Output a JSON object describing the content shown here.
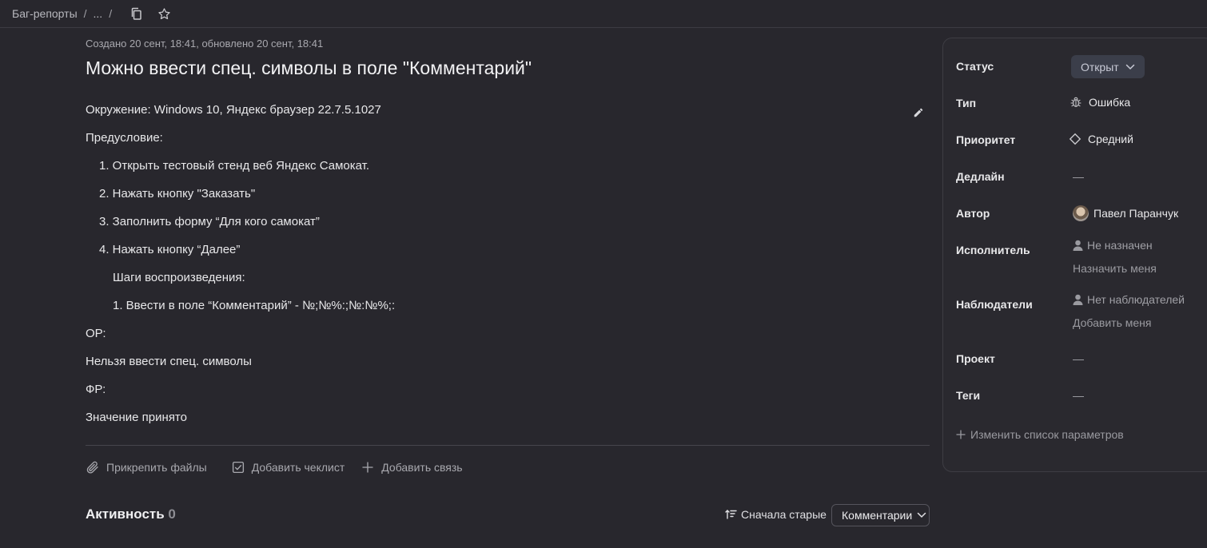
{
  "breadcrumb": {
    "root": "Баг-репорты",
    "ellipsis": "...",
    "separator": "/"
  },
  "issue": {
    "meta": "Создано 20 сент, 18:41, обновлено 20 сент, 18:41",
    "title": "Можно ввести спец. символы в поле \"Комментарий\"",
    "description": [
      "Окружение: Windows 10, Яндекс браузер 22.7.5.1027",
      "Предусловие:",
      "1. Открыть тестовый стенд веб Яндекс Самокат.",
      "2. Нажать кнопку \"Заказать\"",
      "3. Заполнить форму “Для кого самокат”",
      "4. Нажать кнопку “Далее”",
      "Шаги воспроизведения:",
      "1. Ввести в поле “Комментарий” - №;№%:;№:№%;:",
      "ОР:",
      "Нельзя ввести спец. символы",
      "ФР:",
      "Значение принято"
    ]
  },
  "actions": {
    "attach": "Прикрепить файлы",
    "checklist": "Добавить чеклист",
    "link": "Добавить связь"
  },
  "activity": {
    "title": "Активность",
    "count": "0",
    "sort": "Сначала старые",
    "filter": "Комментарии"
  },
  "panel": {
    "status": {
      "label": "Статус",
      "value": "Открыт"
    },
    "type": {
      "label": "Тип",
      "value": "Ошибка"
    },
    "priority": {
      "label": "Приоритет",
      "value": "Средний"
    },
    "deadline": {
      "label": "Дедлайн",
      "value": "—"
    },
    "author": {
      "label": "Автор",
      "value": "Павел Паранчук"
    },
    "assignee": {
      "label": "Исполнитель",
      "value": "Не назначен",
      "action": "Назначить меня"
    },
    "watchers": {
      "label": "Наблюдатели",
      "value": "Нет наблюдателей",
      "action": "Добавить меня"
    },
    "project": {
      "label": "Проект",
      "value": "—"
    },
    "tags": {
      "label": "Теги",
      "value": "—"
    },
    "change_params": "Изменить список параметров"
  }
}
